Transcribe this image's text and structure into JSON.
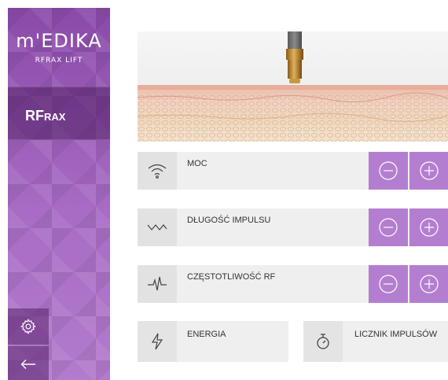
{
  "brand": {
    "name": "m'EDIKA",
    "subtitle": "RFRAX LIFT"
  },
  "sidebar": {
    "nav_item": {
      "label_main": "RF",
      "label_small": "RAX"
    },
    "settings_icon": "gear-icon",
    "back_icon": "arrow-left-icon"
  },
  "controls": {
    "moc": {
      "label": "MOC",
      "icon": "signal-wave-icon"
    },
    "dlugosc": {
      "label": "DŁUGOŚĆ IMPULSU",
      "icon": "pulse-wave-icon"
    },
    "czestotliwosc": {
      "label": "CZĘSTOTLIWOŚĆ RF",
      "icon": "ecg-icon"
    }
  },
  "cards": {
    "energia": {
      "label": "ENERGIA",
      "icon": "lightning-icon"
    },
    "licznik": {
      "label": "LICZNIK IMPULSÓW",
      "icon": "stopwatch-icon"
    }
  },
  "colors": {
    "accent": "#b47ed0",
    "sidebar": "#9a5fb8"
  }
}
